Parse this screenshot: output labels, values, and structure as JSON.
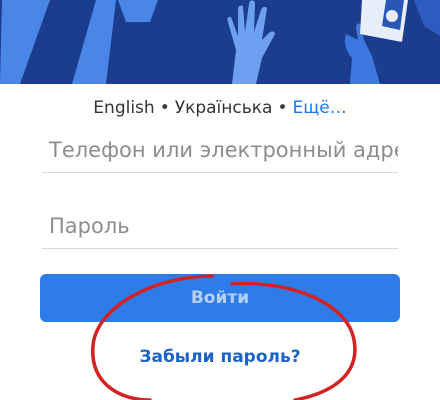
{
  "language_bar": {
    "lang_1": "English",
    "separator": "•",
    "lang_2": "Українська",
    "more": "Ещё…"
  },
  "login_form": {
    "phone_placeholder": "Телефон или электронный адрес",
    "password_placeholder": "Пароль",
    "login_button": "Войти",
    "forgot_password": "Забыли пароль?"
  },
  "colors": {
    "hero_background": "#1c3c8e",
    "hero_illustration": "#4a86e8",
    "primary_button": "#2e7ce9",
    "link": "#1b63c9",
    "annotation_circle": "#d32222"
  },
  "icons": {
    "illustration": "raised-hands-illustration",
    "annotation": "hand-drawn-red-circle"
  }
}
